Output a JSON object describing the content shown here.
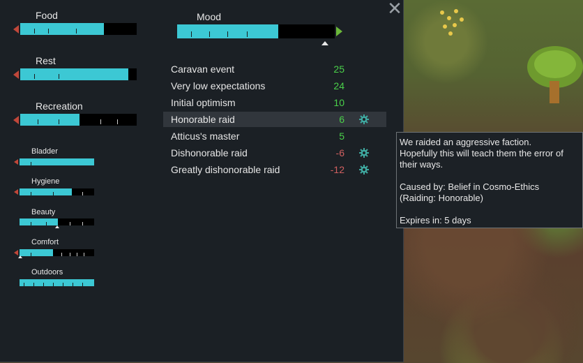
{
  "close_glyph": "✕",
  "needs_large": [
    {
      "label": "Food",
      "level": 0.72
    },
    {
      "label": "Rest",
      "level": 0.93
    },
    {
      "label": "Recreation",
      "level": 0.51
    }
  ],
  "needs_small": [
    {
      "label": "Bladder",
      "level": 1.0
    },
    {
      "label": "Hygiene",
      "level": 0.7
    },
    {
      "label": "Beauty",
      "level": 0.51
    },
    {
      "label": "Comfort",
      "level": 0.45
    },
    {
      "label": "Outdoors",
      "level": 1.0
    }
  ],
  "mood": {
    "label": "Mood",
    "level": 0.64
  },
  "thoughts": [
    {
      "label": "Caravan event",
      "value": "25",
      "sign": "pos",
      "icon": ""
    },
    {
      "label": "Very low expectations",
      "value": "24",
      "sign": "pos",
      "icon": ""
    },
    {
      "label": "Initial optimism",
      "value": "10",
      "sign": "pos",
      "icon": ""
    },
    {
      "label": "Honorable raid",
      "value": "6",
      "sign": "pos",
      "icon": "ideology-gear-icon"
    },
    {
      "label": "Atticus's master",
      "value": "5",
      "sign": "pos",
      "icon": ""
    },
    {
      "label": "Dishonorable raid",
      "value": "-6",
      "sign": "neg",
      "icon": "ideology-gear-icon"
    },
    {
      "label": "Greatly dishonorable raid",
      "value": "-12",
      "sign": "neg",
      "icon": "ideology-gear-icon"
    }
  ],
  "tooltip": {
    "line1": "We raided an aggressive faction.",
    "line2": "Hopefully this will teach them the error of",
    "line3": "their ways.",
    "line4": "Caused by: Belief in Cosmo-Ethics",
    "line5": "(Raiding: Honorable)",
    "line6": "Expires in: 5 days"
  },
  "colors": {
    "bar": "#3cc8d4",
    "positive": "#4ad14a",
    "negative": "#d06060"
  }
}
